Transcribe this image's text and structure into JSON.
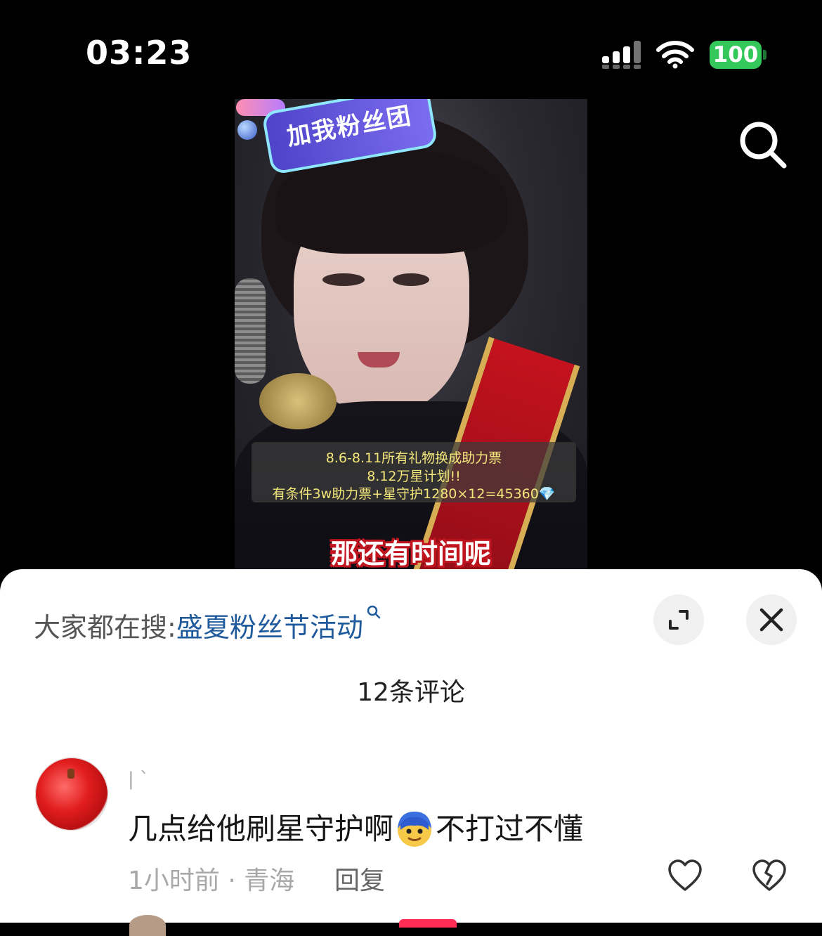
{
  "status_bar": {
    "time": "03:23",
    "battery": "100",
    "battery_color": "#34c759"
  },
  "top_bar": {
    "search_icon": "search-icon"
  },
  "video": {
    "badge_text": "加我粉丝团",
    "info_lines": [
      "8.6-8.11所有礼物换成助力票",
      "8.12万星计划!!",
      "有条件3w助力票+星守护1280×12=45360💎"
    ],
    "caption": "那还有时间呢"
  },
  "sheet": {
    "search_label": "大家都在搜:",
    "search_term": "盛夏粉丝节活动",
    "search_term_color": "#1f5a9c",
    "expand_icon": "expand-icon",
    "close_icon": "close-icon",
    "comment_count": "12条评论"
  },
  "comments": [
    {
      "username": "|  `",
      "text_before": "几点给他刷星守护啊",
      "emoji": "cool-face-emoji",
      "text_after": "不打过不懂",
      "time": "1小时前 · 青海",
      "reply_label": "回复",
      "like_icon": "heart-icon",
      "dislike_icon": "broken-heart-icon"
    }
  ]
}
